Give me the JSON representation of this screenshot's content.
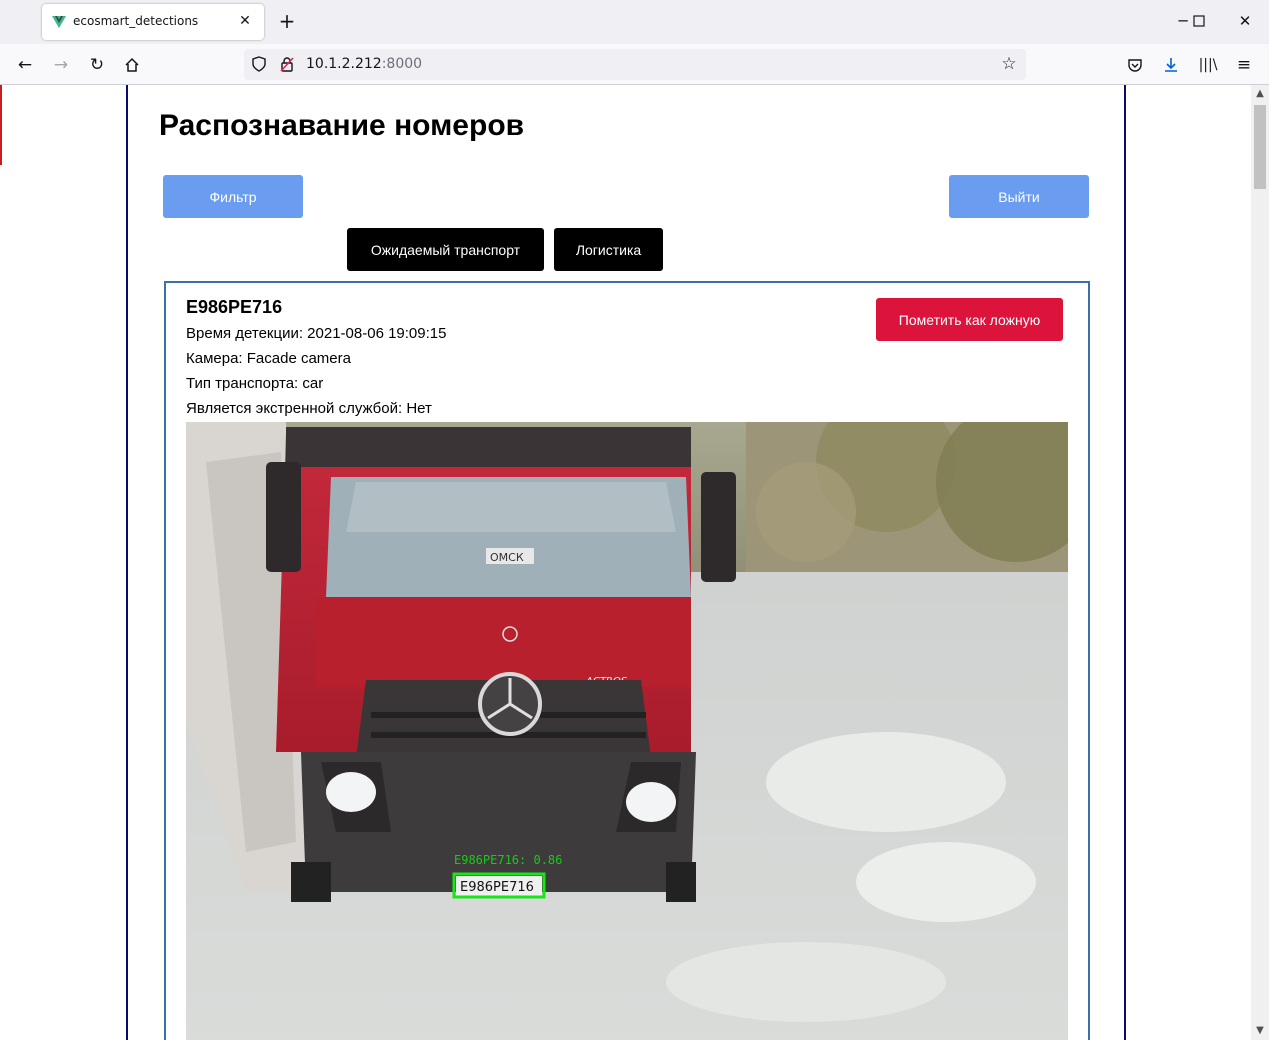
{
  "browser": {
    "tab_title": "ecosmart_detections",
    "url_host": "10.1.2.212",
    "url_port": ":8000"
  },
  "page": {
    "title": "Распознавание номеров",
    "filter_button": "Фильтр",
    "logout_button": "Выйти",
    "expected_transport_button": "Ожидаемый транспорт",
    "logistics_button": "Логистика"
  },
  "detection": {
    "plate": "E986PE716",
    "time": "Время детекции: 2021-08-06 19:09:15",
    "camera": "Камера: Facade camera",
    "vehicle_type": "Тип транспорта: car",
    "emergency": "Является экстренной службой: Нет",
    "mark_false_button": "Пометить как ложную",
    "image_overlay_label": "E986PE716: 0.86",
    "image_plate_text": "E986PE716",
    "image_sign_text": "ОМСК",
    "image_model_text": "ACTROS"
  },
  "colors": {
    "accent_blue": "#6a9cf0",
    "danger_red": "#dc143c",
    "card_border": "#3a6fa8",
    "container_border": "#0a0a73",
    "detection_box": "#19e619"
  }
}
